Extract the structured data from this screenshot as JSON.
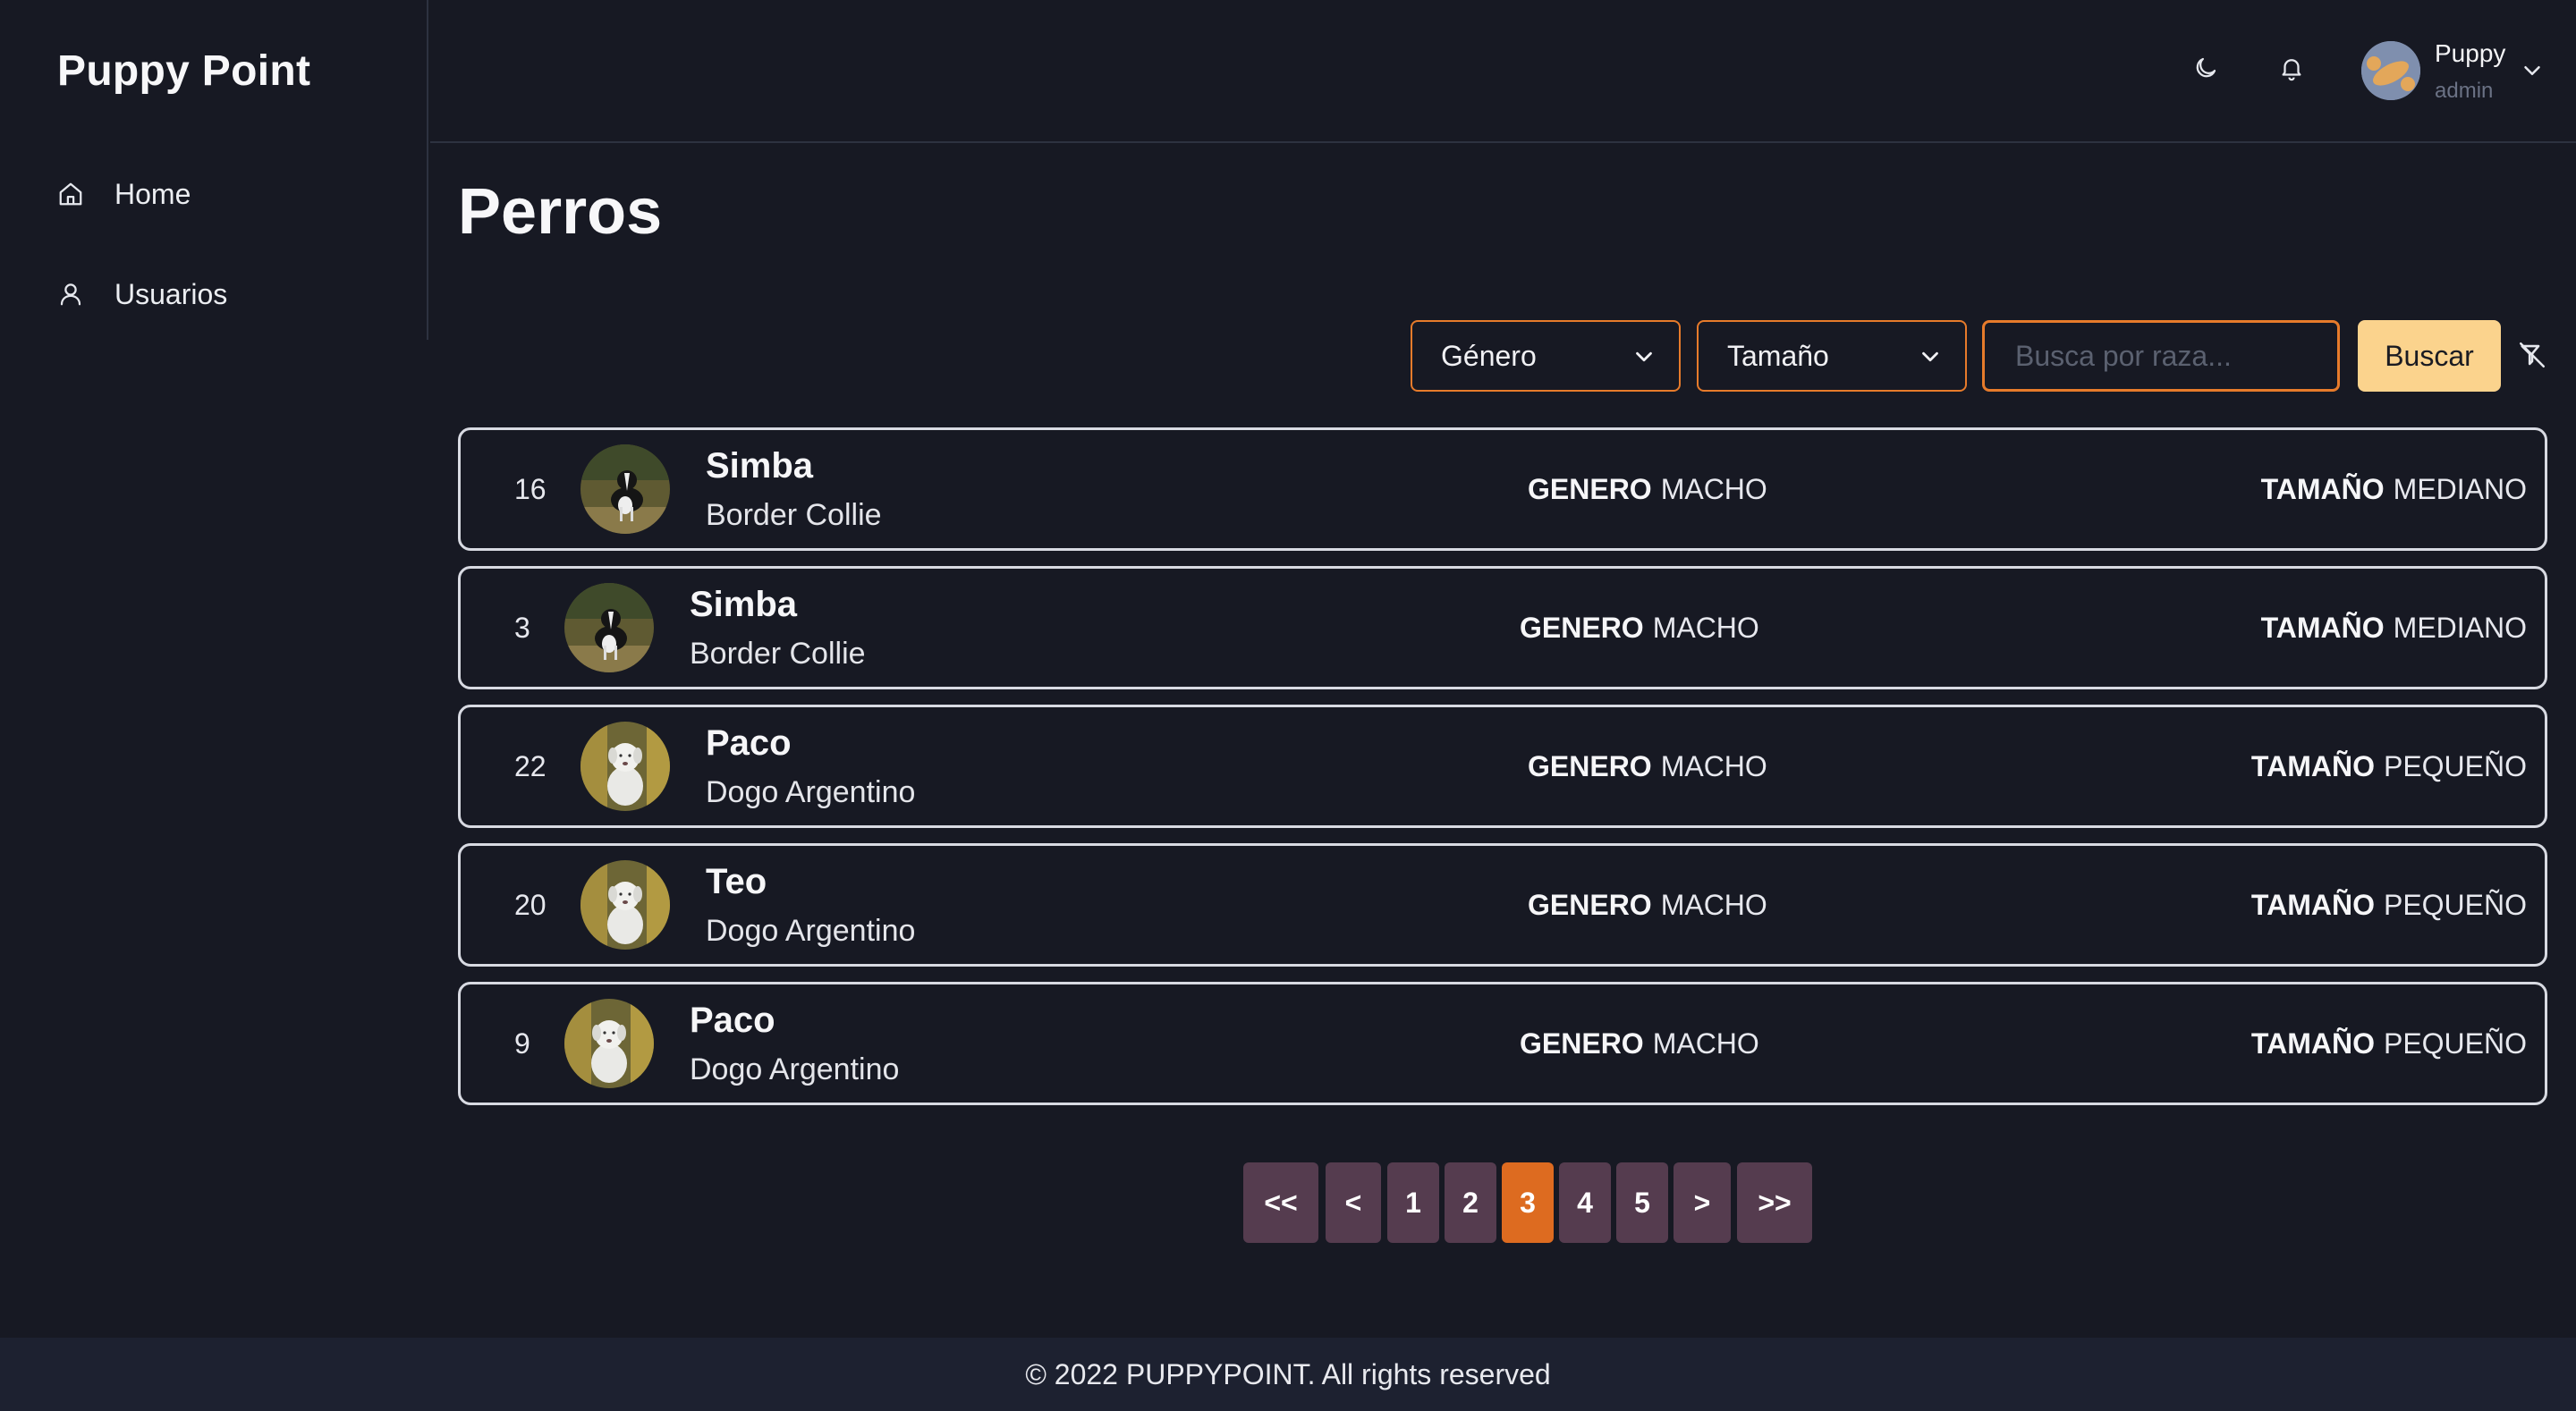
{
  "app": {
    "brand": "Puppy Point"
  },
  "sidebar": {
    "items": [
      {
        "label": "Home",
        "icon": "home-icon"
      },
      {
        "label": "Usuarios",
        "icon": "user-icon"
      }
    ]
  },
  "topbar": {
    "theme_icon": "moon-icon",
    "notifications_icon": "bell-icon",
    "user": {
      "name": "Puppy",
      "role": "admin",
      "avatar_icon": "avatar"
    }
  },
  "main": {
    "title": "Perros",
    "filters": {
      "gender_select": "Género",
      "size_select": "Tamaño",
      "search_placeholder": "Busca por raza...",
      "search_button": "Buscar",
      "clear_filter_icon": "filter-off-icon"
    },
    "field_labels": {
      "gender": "GENERO",
      "size": "TAMAÑO"
    },
    "dogs": [
      {
        "id": "16",
        "name": "Simba",
        "breed": "Border Collie",
        "gender": "MACHO",
        "size": "MEDIANO",
        "photo": "border-collie"
      },
      {
        "id": "3",
        "name": "Simba",
        "breed": "Border Collie",
        "gender": "MACHO",
        "size": "MEDIANO",
        "photo": "border-collie"
      },
      {
        "id": "22",
        "name": "Paco",
        "breed": "Dogo Argentino",
        "gender": "MACHO",
        "size": "PEQUEÑO",
        "photo": "dogo-argentino"
      },
      {
        "id": "20",
        "name": "Teo",
        "breed": "Dogo Argentino",
        "gender": "MACHO",
        "size": "PEQUEÑO",
        "photo": "dogo-argentino"
      },
      {
        "id": "9",
        "name": "Paco",
        "breed": "Dogo Argentino",
        "gender": "MACHO",
        "size": "PEQUEÑO",
        "photo": "dogo-argentino"
      }
    ],
    "pagination": {
      "first": "<<",
      "prev": "<",
      "pages": [
        "1",
        "2",
        "3",
        "4",
        "5"
      ],
      "current": "3",
      "next": ">",
      "last": ">>"
    }
  },
  "footer": {
    "text": "© 2022 PUPPYPOINT. All rights reserved"
  },
  "colors": {
    "background": "#171923",
    "accent": "#e77b2b",
    "search_button": "#fbd38d",
    "pager": "#553c4f",
    "pager_active": "#dd6b20",
    "footer": "#1d2130"
  }
}
